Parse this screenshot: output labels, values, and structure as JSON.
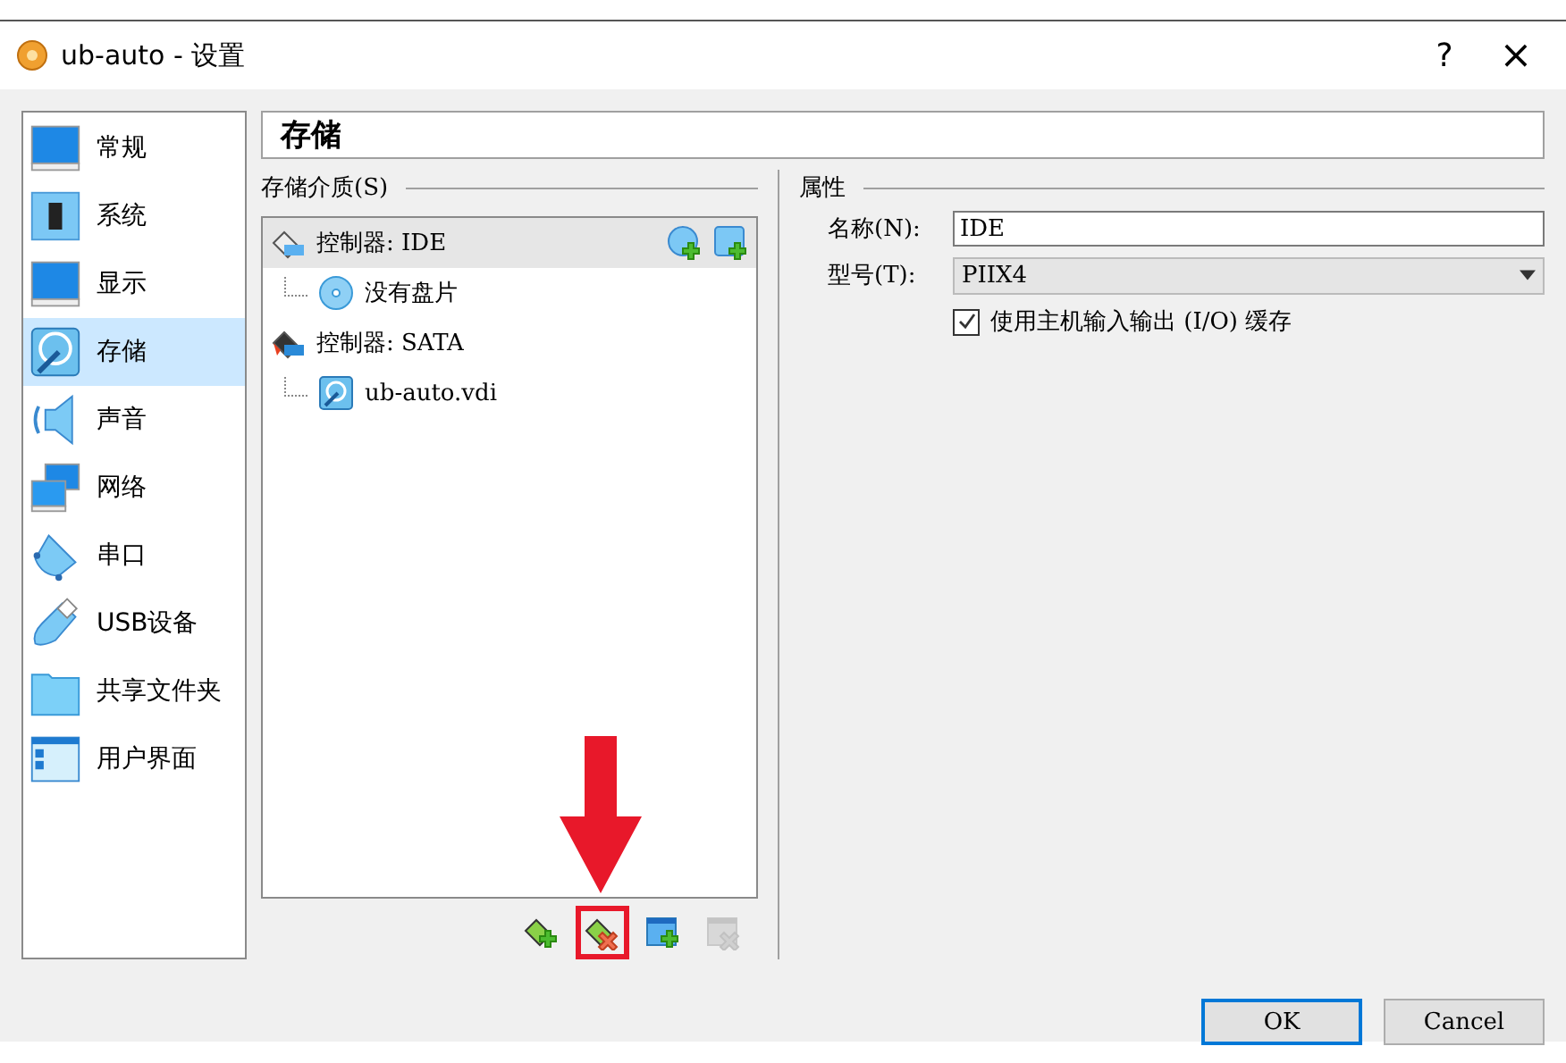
{
  "window": {
    "title": "ub-auto - 设置",
    "help": "?",
    "close": "×"
  },
  "sidebar": {
    "items": [
      {
        "label": "常规",
        "kind": "general",
        "selected": false
      },
      {
        "label": "系统",
        "kind": "system",
        "selected": false
      },
      {
        "label": "显示",
        "kind": "display",
        "selected": false
      },
      {
        "label": "存储",
        "kind": "storage",
        "selected": true
      },
      {
        "label": "声音",
        "kind": "audio",
        "selected": false
      },
      {
        "label": "网络",
        "kind": "network",
        "selected": false
      },
      {
        "label": "串口",
        "kind": "serial",
        "selected": false
      },
      {
        "label": "USB设备",
        "kind": "usb",
        "selected": false
      },
      {
        "label": "共享文件夹",
        "kind": "folder",
        "selected": false
      },
      {
        "label": "用户界面",
        "kind": "ui",
        "selected": false
      }
    ]
  },
  "page_title": "存储",
  "storage": {
    "label": "存储介质(S)",
    "tree": [
      {
        "label": "控制器: IDE",
        "kind": "ide",
        "selected": true,
        "children": [
          {
            "label": "没有盘片",
            "kind": "optical"
          }
        ]
      },
      {
        "label": "控制器: SATA",
        "kind": "sata",
        "selected": false,
        "children": [
          {
            "label": "ub-auto.vdi",
            "kind": "disk"
          }
        ]
      }
    ],
    "toolbar": [
      {
        "kind": "add-controller",
        "disabled": false,
        "highlighted": false
      },
      {
        "kind": "remove-controller",
        "disabled": false,
        "highlighted": true
      },
      {
        "kind": "add-attachment",
        "disabled": false,
        "highlighted": false
      },
      {
        "kind": "remove-attachment",
        "disabled": true,
        "highlighted": false
      }
    ]
  },
  "properties": {
    "label": "属性",
    "name": {
      "label": "名称(N):",
      "value": "IDE"
    },
    "type": {
      "label": "型号(T):",
      "value": "PIIX4"
    },
    "cache": {
      "label": "使用主机输入输出 (I/O) 缓存",
      "checked": true
    }
  },
  "buttons": [
    {
      "label": "OK",
      "default": true
    },
    {
      "label": "Cancel",
      "default": false
    }
  ]
}
